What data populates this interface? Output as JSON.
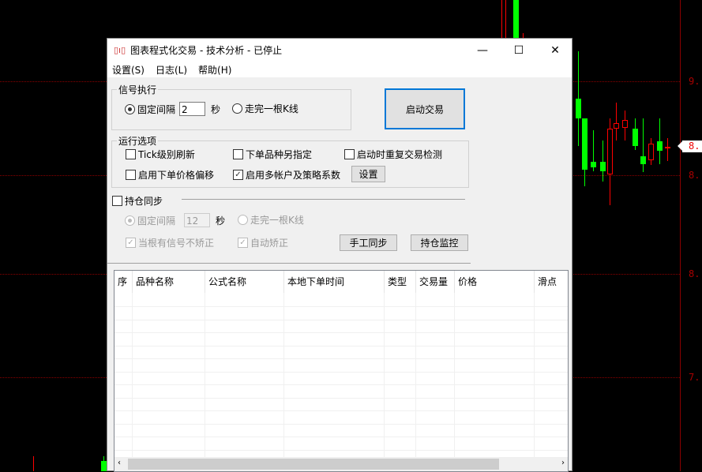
{
  "window": {
    "title": "图表程式化交易 - 技术分析 - 已停止",
    "minimize": "—",
    "maximize": "☐",
    "close": "✕"
  },
  "menu": [
    "设置(S)",
    "日志(L)",
    "帮助(H)"
  ],
  "signal": {
    "legend": "信号执行",
    "fixed_interval": "固定间隔",
    "interval_value": "2",
    "seconds": "秒",
    "per_bar": "走完一根K线",
    "selected": "fixed_interval"
  },
  "start_button": "启动交易",
  "options": {
    "legend": "运行选项",
    "items": [
      {
        "label": "Tick级别刷新",
        "checked": false
      },
      {
        "label": "下单品种另指定",
        "checked": false
      },
      {
        "label": "启动时重复交易检测",
        "checked": false
      },
      {
        "label": "启用下单价格偏移",
        "checked": false
      },
      {
        "label": "启用多帐户及策略系数",
        "checked": true
      }
    ],
    "settings_button": "设置"
  },
  "position_sync": {
    "label": "持仓同步",
    "checked": false,
    "fixed_interval": "固定间隔",
    "interval_value": "12",
    "seconds": "秒",
    "per_bar": "走完一根K线",
    "no_correct": "当根有信号不矫正",
    "auto_correct": "自动矫正",
    "manual_sync": "手工同步",
    "monitor": "持仓监控"
  },
  "table": {
    "columns": [
      "序",
      "品种名称",
      "公式名称",
      "本地下单时间",
      "类型",
      "交易量",
      "价格",
      "滑点"
    ],
    "rows": []
  },
  "chart": {
    "y_labels": [
      "9.",
      "8.",
      "8.",
      "7."
    ],
    "current_price": "8.",
    "up_color": "#ff0000",
    "down_color": "#00ff00"
  }
}
